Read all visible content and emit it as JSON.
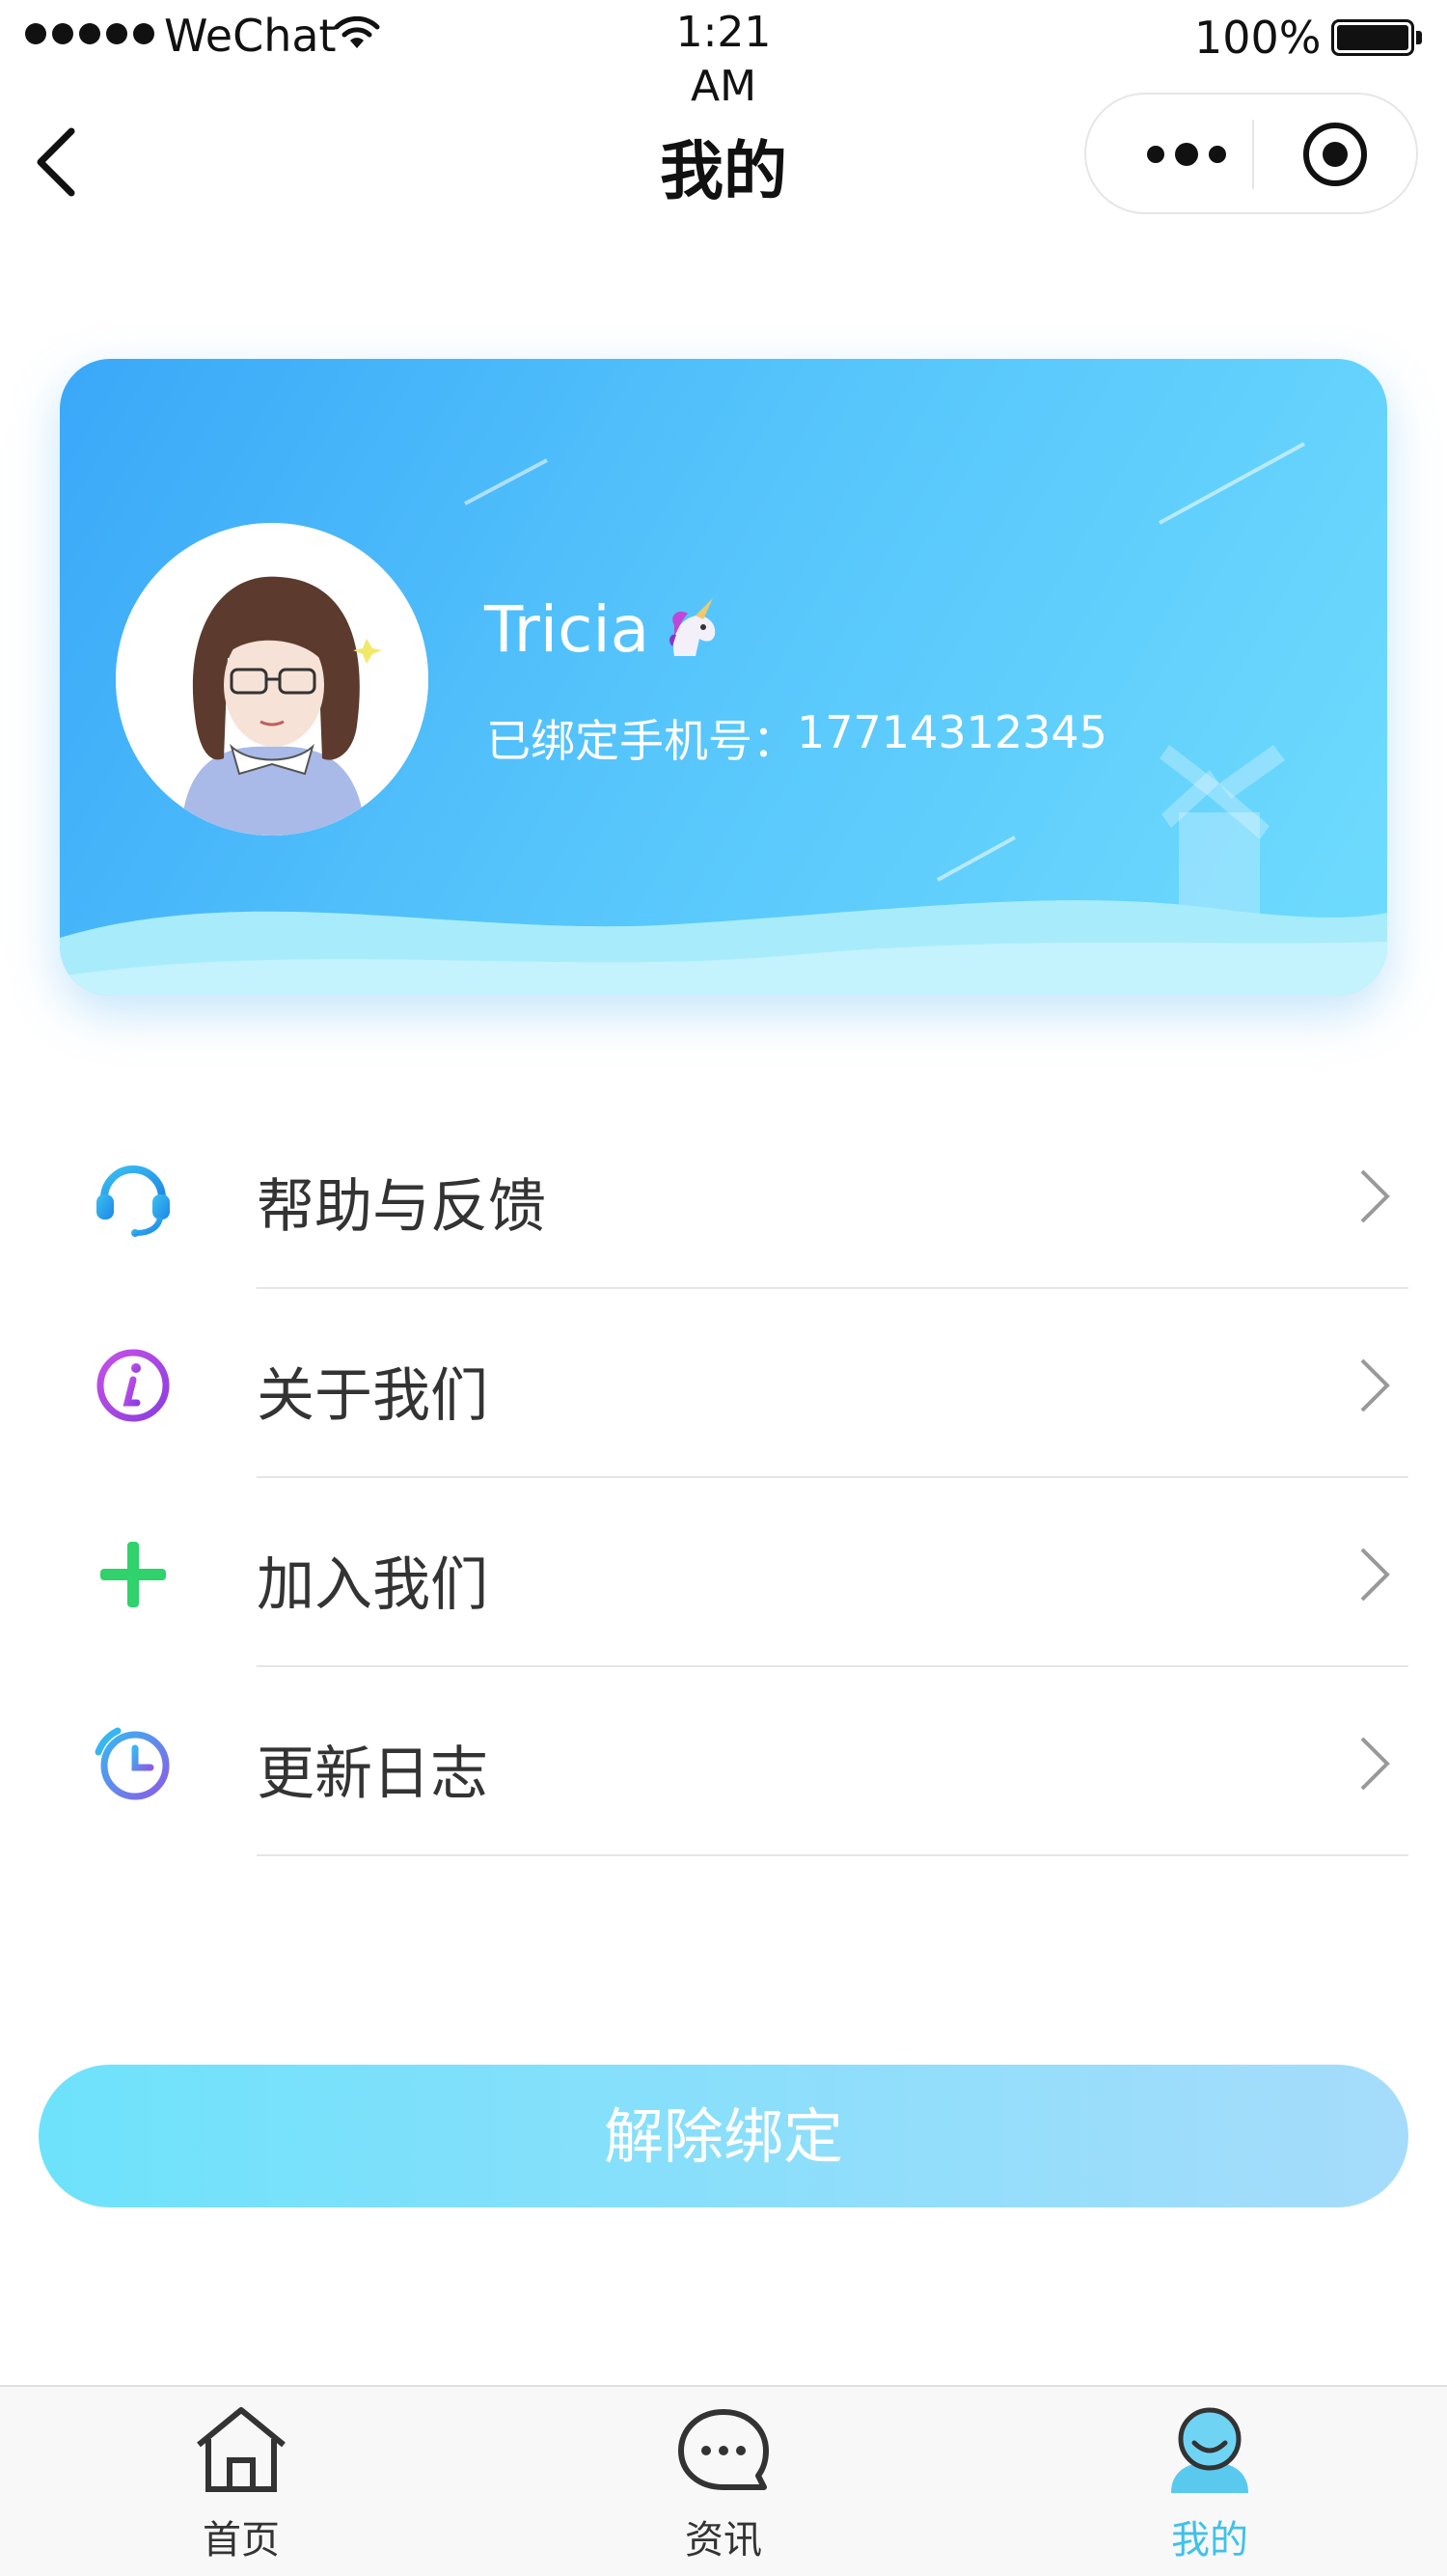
{
  "status_bar": {
    "carrier": "WeChat",
    "time": "1:21\nAM",
    "battery": "100%"
  },
  "nav": {
    "title": "我的"
  },
  "profile": {
    "name": "Tricia",
    "phone_label": "已绑定手机号：",
    "phone": "17714312345"
  },
  "menu": {
    "items": [
      {
        "label": "帮助与反馈",
        "icon": "headset-icon"
      },
      {
        "label": "关于我们",
        "icon": "info-icon"
      },
      {
        "label": "加入我们",
        "icon": "plus-icon"
      },
      {
        "label": "更新日志",
        "icon": "clock-icon"
      }
    ]
  },
  "actions": {
    "unbind_label": "解除绑定"
  },
  "tabbar": {
    "tabs": [
      {
        "label": "首页",
        "icon": "home-icon"
      },
      {
        "label": "资讯",
        "icon": "chat-bubble-icon"
      },
      {
        "label": "我的",
        "icon": "user-icon"
      }
    ],
    "active_index": 2
  },
  "colors": {
    "accent": "#3ec1ec",
    "card_start": "#3aa8f8",
    "card_end": "#6fdcfd",
    "info_purple": "#b04de8",
    "plus_green": "#2fd26b"
  }
}
